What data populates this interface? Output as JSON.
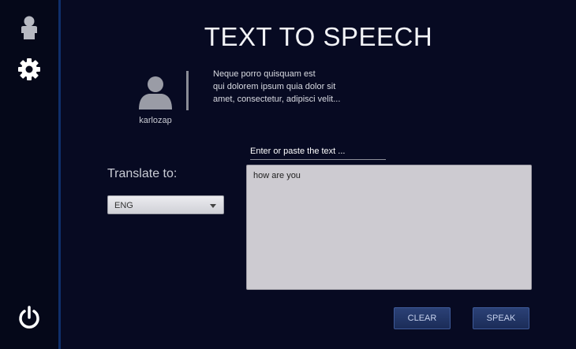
{
  "sidebar": {
    "icons": [
      "person-icon",
      "gear-icon",
      "power-icon"
    ]
  },
  "header": {
    "title": "TEXT TO SPEECH"
  },
  "profile": {
    "username": "karlozap",
    "bio_lines": [
      "Neque porro quisquam est",
      "qui  dolorem  ipsum  quia  dolor  sit",
      "amet, consectetur, adipisci velit..."
    ]
  },
  "form": {
    "text_label": "Enter or paste the text ...",
    "translate_label": "Translate to:",
    "language_selected": "ENG",
    "input_text": "how are you"
  },
  "buttons": {
    "clear": "CLEAR",
    "speak": "SPEAK"
  },
  "colors": {
    "background": "#070a22",
    "sidebar": "#050819",
    "accent_border": "#0f2f6b",
    "button": "#1f3163",
    "textarea": "#cdcbd1"
  }
}
